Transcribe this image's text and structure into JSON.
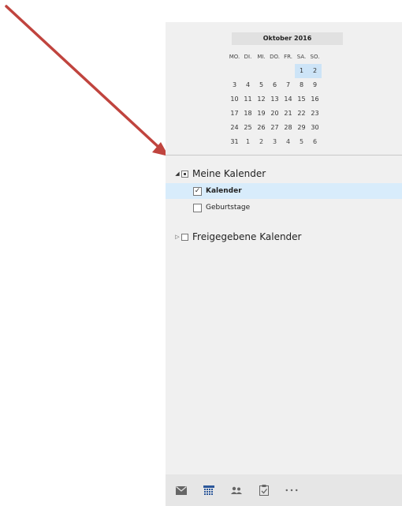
{
  "calendar": {
    "month_title": "Oktober 2016",
    "weekdays": [
      "MO.",
      "DI.",
      "MI.",
      "DO.",
      "FR.",
      "SA.",
      "SO."
    ],
    "weeks": [
      [
        "",
        "",
        "",
        "",
        "",
        "1",
        "2"
      ],
      [
        "3",
        "4",
        "5",
        "6",
        "7",
        "8",
        "9"
      ],
      [
        "10",
        "11",
        "12",
        "13",
        "14",
        "15",
        "16"
      ],
      [
        "17",
        "18",
        "19",
        "20",
        "21",
        "22",
        "23"
      ],
      [
        "24",
        "25",
        "26",
        "27",
        "28",
        "29",
        "30"
      ],
      [
        "31",
        "1",
        "2",
        "3",
        "4",
        "5",
        "6"
      ]
    ]
  },
  "folders": {
    "my_calendars": {
      "label": "Meine Kalender",
      "items": [
        {
          "label": "Kalender",
          "checked": "✓"
        },
        {
          "label": "Geburtstage",
          "checked": ""
        }
      ]
    },
    "shared_calendars": {
      "label": "Freigegebene Kalender"
    }
  },
  "nav_icons": [
    "mail-icon",
    "calendar-icon",
    "people-icon",
    "tasks-icon",
    "more-icon"
  ],
  "colors": {
    "arrow": "#c0443e",
    "selection": "#d8ecfb",
    "accent": "#2b579a"
  }
}
